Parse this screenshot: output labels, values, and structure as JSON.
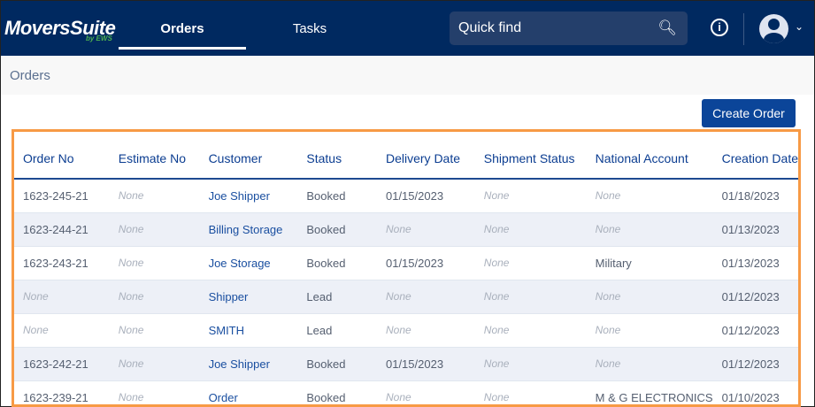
{
  "header": {
    "logo": "MoversSuite",
    "logo_sub": "by EWS",
    "tabs": [
      {
        "label": "Orders",
        "active": true
      },
      {
        "label": "Tasks",
        "active": false
      }
    ],
    "search_placeholder": "Quick find",
    "icons": [
      "search-icon",
      "info-icon",
      "user-avatar-icon",
      "chevron-down-icon"
    ]
  },
  "breadcrumb": "Orders",
  "toolbar": {
    "create_label": "Create Order"
  },
  "colors": {
    "header": "#002960",
    "accent": "#0b4599",
    "highlight": "#f79a45"
  },
  "table": {
    "columns": [
      "Order No",
      "Estimate No",
      "Customer",
      "Status",
      "Delivery Date",
      "Shipment Status",
      "National Account",
      "Creation Date"
    ],
    "rows": [
      [
        "1623-245-21",
        "None",
        "Joe Shipper",
        "Booked",
        "01/15/2023",
        "None",
        "None",
        "01/18/2023"
      ],
      [
        "1623-244-21",
        "None",
        "Billing Storage",
        "Booked",
        "None",
        "None",
        "None",
        "01/13/2023"
      ],
      [
        "1623-243-21",
        "None",
        "Joe Storage",
        "Booked",
        "01/15/2023",
        "None",
        "Military",
        "01/13/2023"
      ],
      [
        "None",
        "None",
        "Shipper",
        "Lead",
        "None",
        "None",
        "None",
        "01/12/2023"
      ],
      [
        "None",
        "None",
        "SMITH",
        "Lead",
        "None",
        "None",
        "None",
        "01/12/2023"
      ],
      [
        "1623-242-21",
        "None",
        "Joe Shipper",
        "Booked",
        "01/15/2023",
        "None",
        "None",
        "01/12/2023"
      ],
      [
        "1623-239-21",
        "None",
        "Order",
        "Booked",
        "None",
        "None",
        "M & G ELECTRONICS",
        "01/10/2023"
      ]
    ]
  }
}
